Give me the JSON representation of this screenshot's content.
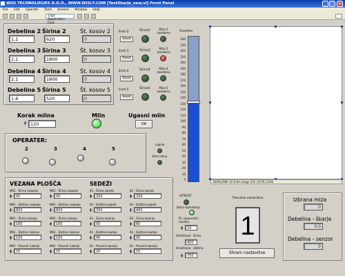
{
  "window": {
    "title": "WISI TECHNOLOGIES D.O.O., WWW.WISI-T.COM [TestSkarje_new.vi] Front Panel"
  },
  "menu": [
    "File",
    "Edit",
    "Operate",
    "Tools",
    "Browse",
    "Window",
    "Help"
  ],
  "toolbar": {
    "font": "13pt Application Font"
  },
  "debelina": [
    {
      "label": "Debelina 2",
      "value": "1,1"
    },
    {
      "label": "Debelina 3",
      "value": "2,1"
    },
    {
      "label": "Debelina 4",
      "value": "2,1"
    },
    {
      "label": "Debelina 5",
      "value": "1,6"
    }
  ],
  "sirina": [
    {
      "label": "Širina 2",
      "value": "620"
    },
    {
      "label": "Širina 3",
      "value": "1800"
    },
    {
      "label": "Širina 4",
      "value": "1800"
    },
    {
      "label": "Širina 5",
      "value": "520"
    }
  ],
  "kosov": [
    {
      "label": "Št. kosov 2",
      "value": "0"
    },
    {
      "label": "Št. kosov 3",
      "value": "0"
    },
    {
      "label": "Št. kosov 4",
      "value": "0"
    },
    {
      "label": "Št. kosov 5",
      "value": "0"
    }
  ],
  "emit": [
    {
      "label": "Emit 2",
      "reset": "Reset"
    },
    {
      "label": "Emit 3",
      "reset": "Reset"
    },
    {
      "label": "Emit 4",
      "reset": "Reset"
    },
    {
      "label": "Emit 5",
      "reset": "Reset"
    }
  ],
  "sirina_leds": [
    "Širina2",
    "Širina3",
    "Širina4",
    "Širina5"
  ],
  "miza": [
    "Miza 2 zasedena",
    "Miza 3 zasedena",
    "Miza 4 zasedena",
    "Miza 5 zasedena"
  ],
  "overitev": {
    "label": "Overitev",
    "ticks": [
      "240",
      "230",
      "220",
      "210",
      "200",
      "190",
      "180",
      "170",
      "160",
      "150",
      "140",
      "130",
      "120",
      "110",
      "100",
      "90",
      "80",
      "70",
      "60",
      "50",
      "40",
      "30",
      "20",
      "10",
      "0"
    ],
    "level": 131,
    "max": 240
  },
  "image": {
    "status": "1649x2080 1X 8-bit image 255    (1076,1240)"
  },
  "korak": {
    "label": "Korak mlina",
    "value": "120"
  },
  "mlin": {
    "label": "Mlin"
  },
  "ugasni": {
    "label": "Ugasni mlin",
    "button": "OK"
  },
  "operater": {
    "label": "OPERATER:",
    "numbers": [
      "2",
      "3",
      "4",
      "5"
    ]
  },
  "lupula": {
    "label1": "Lapula",
    "label2": "Brez mlina"
  },
  "vezana": {
    "title": "VEZANA PLOŠČA",
    "fields": [
      {
        "label": "MK1 - Širina razpoke",
        "value": "50"
      },
      {
        "label": "MK2 - Širina razpoke",
        "value": "50"
      },
      {
        "label": "MK1 - Dolžina razpoke",
        "value": "600"
      },
      {
        "label": "MK2 - Dolžina razpoke",
        "value": "600"
      },
      {
        "label": "MK1 - Širina lukenje",
        "value": "160"
      },
      {
        "label": "MK2 - Širina lukenje",
        "value": "160"
      },
      {
        "label": "MK1 - Dolžina lukenje",
        "value": "160"
      },
      {
        "label": "MK2 - Dolžina lukenje",
        "value": "160"
      },
      {
        "label": "MK1 - Procent lukenje",
        "value": "15"
      },
      {
        "label": "MK2 - Procent lukenje",
        "value": "15"
      }
    ]
  },
  "sedezi": {
    "title": "SEDEŽI",
    "fields": [
      {
        "label": "K1 - Širina zajede",
        "value": "200"
      },
      {
        "label": "K2 - Širina zajede",
        "value": "200"
      },
      {
        "label": "K1 - Dolžina zajede",
        "value": "350"
      },
      {
        "label": "K2 - Dolžina zajede",
        "value": "400"
      },
      {
        "label": "K1 - Širina lukenje",
        "value": "50"
      },
      {
        "label": "K2 - Širina lukenje",
        "value": "80"
      },
      {
        "label": "K1 - Dolžina lukenje",
        "value": "40"
      },
      {
        "label": "K2 - Dolžina lukenje",
        "value": "90"
      },
      {
        "label": "K1 - Procent lukenje",
        "value": "20"
      },
      {
        "label": "K2 - Procent lukenje",
        "value": "15"
      }
    ]
  },
  "metrology": {
    "hitrost": "HITROST",
    "izbira": "Izbira Operaterja",
    "nap": "Št. zaporednih meritev",
    "nap_value": "10",
    "sirina_label": "Izhoščanje - širina",
    "sirina_value": "400",
    "dolzina_label": "Izhoščanje - dolžina",
    "dolzina_value": "750"
  },
  "trenutne": {
    "label": "Trenutne nastavitve",
    "value": "1",
    "button": "Shrani nastavitve"
  },
  "right": {
    "izbrana": "Izbrana miza",
    "izbrana_value": "0",
    "skarje": "Debelina - škarje",
    "skarje_value": "0,0",
    "senzor": "Debelina - senzor",
    "senzor_value": "0"
  }
}
